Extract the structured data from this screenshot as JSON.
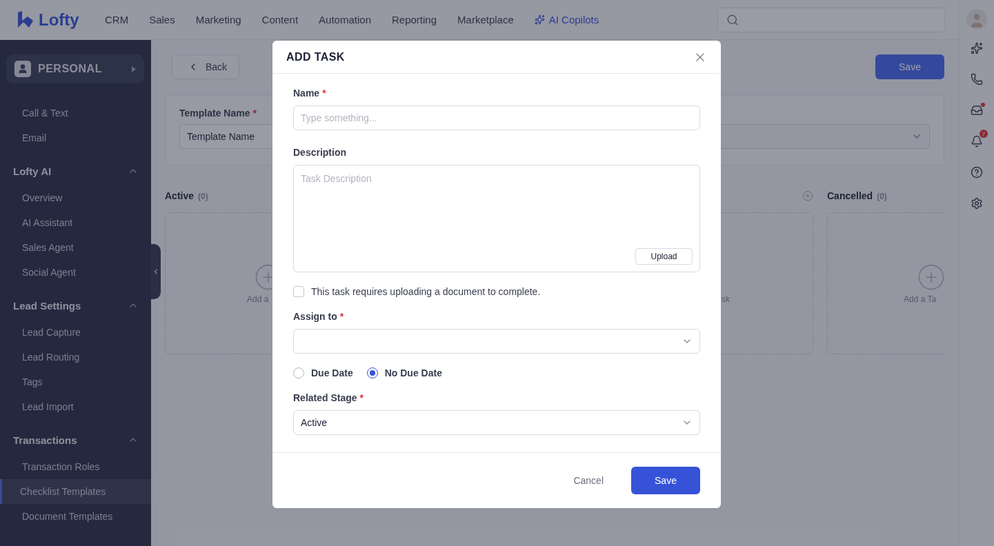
{
  "nav": {
    "logo": "Lofty",
    "links": [
      {
        "label": "CRM",
        "kind": "plain"
      },
      {
        "label": "Sales",
        "kind": "plain"
      },
      {
        "label": "Marketing",
        "kind": "plain"
      },
      {
        "label": "Content",
        "kind": "plain"
      },
      {
        "label": "Automation",
        "kind": "plain"
      },
      {
        "label": "Reporting",
        "kind": "plain"
      },
      {
        "label": "Marketplace",
        "kind": "plain"
      },
      {
        "label": "AI Copilots",
        "kind": "ai"
      }
    ]
  },
  "rail": {
    "inbox_unread": true,
    "notifications": "7"
  },
  "sidebar": {
    "account": "PERSONAL",
    "top_items": [
      {
        "label": "Call & Text",
        "selected": false
      },
      {
        "label": "Email",
        "selected": false
      }
    ],
    "groups": [
      {
        "title": "Lofty AI",
        "expanded": true,
        "items": [
          {
            "label": "Overview",
            "selected": false
          },
          {
            "label": "AI Assistant",
            "selected": false
          },
          {
            "label": "Sales Agent",
            "selected": false
          },
          {
            "label": "Social Agent",
            "selected": false
          }
        ]
      },
      {
        "title": "Lead Settings",
        "expanded": true,
        "items": [
          {
            "label": "Lead Capture",
            "selected": false
          },
          {
            "label": "Lead Routing",
            "selected": false
          },
          {
            "label": "Tags",
            "selected": false
          },
          {
            "label": "Lead Import",
            "selected": false
          }
        ]
      },
      {
        "title": "Transactions",
        "expanded": true,
        "items": [
          {
            "label": "Transaction Roles",
            "selected": false
          },
          {
            "label": "Checklist Templates",
            "selected": true
          },
          {
            "label": "Document Templates",
            "selected": false
          }
        ]
      }
    ]
  },
  "page": {
    "back": "Back",
    "save": "Save",
    "template_name": {
      "label": "Template Name",
      "mark": "*",
      "value": "Template Name"
    },
    "columns": [
      {
        "title": "Active",
        "count": "(0)",
        "add_label": "Add a"
      },
      {
        "add_label": "sk",
        "header_add": true
      },
      {
        "title": "Cancelled",
        "count": "(0)",
        "add_label": "Add a Ta"
      }
    ]
  },
  "modal": {
    "title": "ADD TASK",
    "name": {
      "label": "Name",
      "mark": "*",
      "placeholder": "Type something..."
    },
    "description": {
      "label": "Description",
      "placeholder": "Task Description",
      "upload": "Upload"
    },
    "requires_document": {
      "label": "This task requires uploading a document to complete.",
      "checked": false
    },
    "assign_to": {
      "label": "Assign to",
      "mark": "*"
    },
    "due": [
      {
        "label": "Due Date",
        "selected": false
      },
      {
        "label": "No Due Date",
        "selected": true
      }
    ],
    "related_stage": {
      "label": "Related Stage",
      "mark": "*",
      "value": "Active"
    },
    "cancel": "Cancel",
    "save": "Save"
  }
}
